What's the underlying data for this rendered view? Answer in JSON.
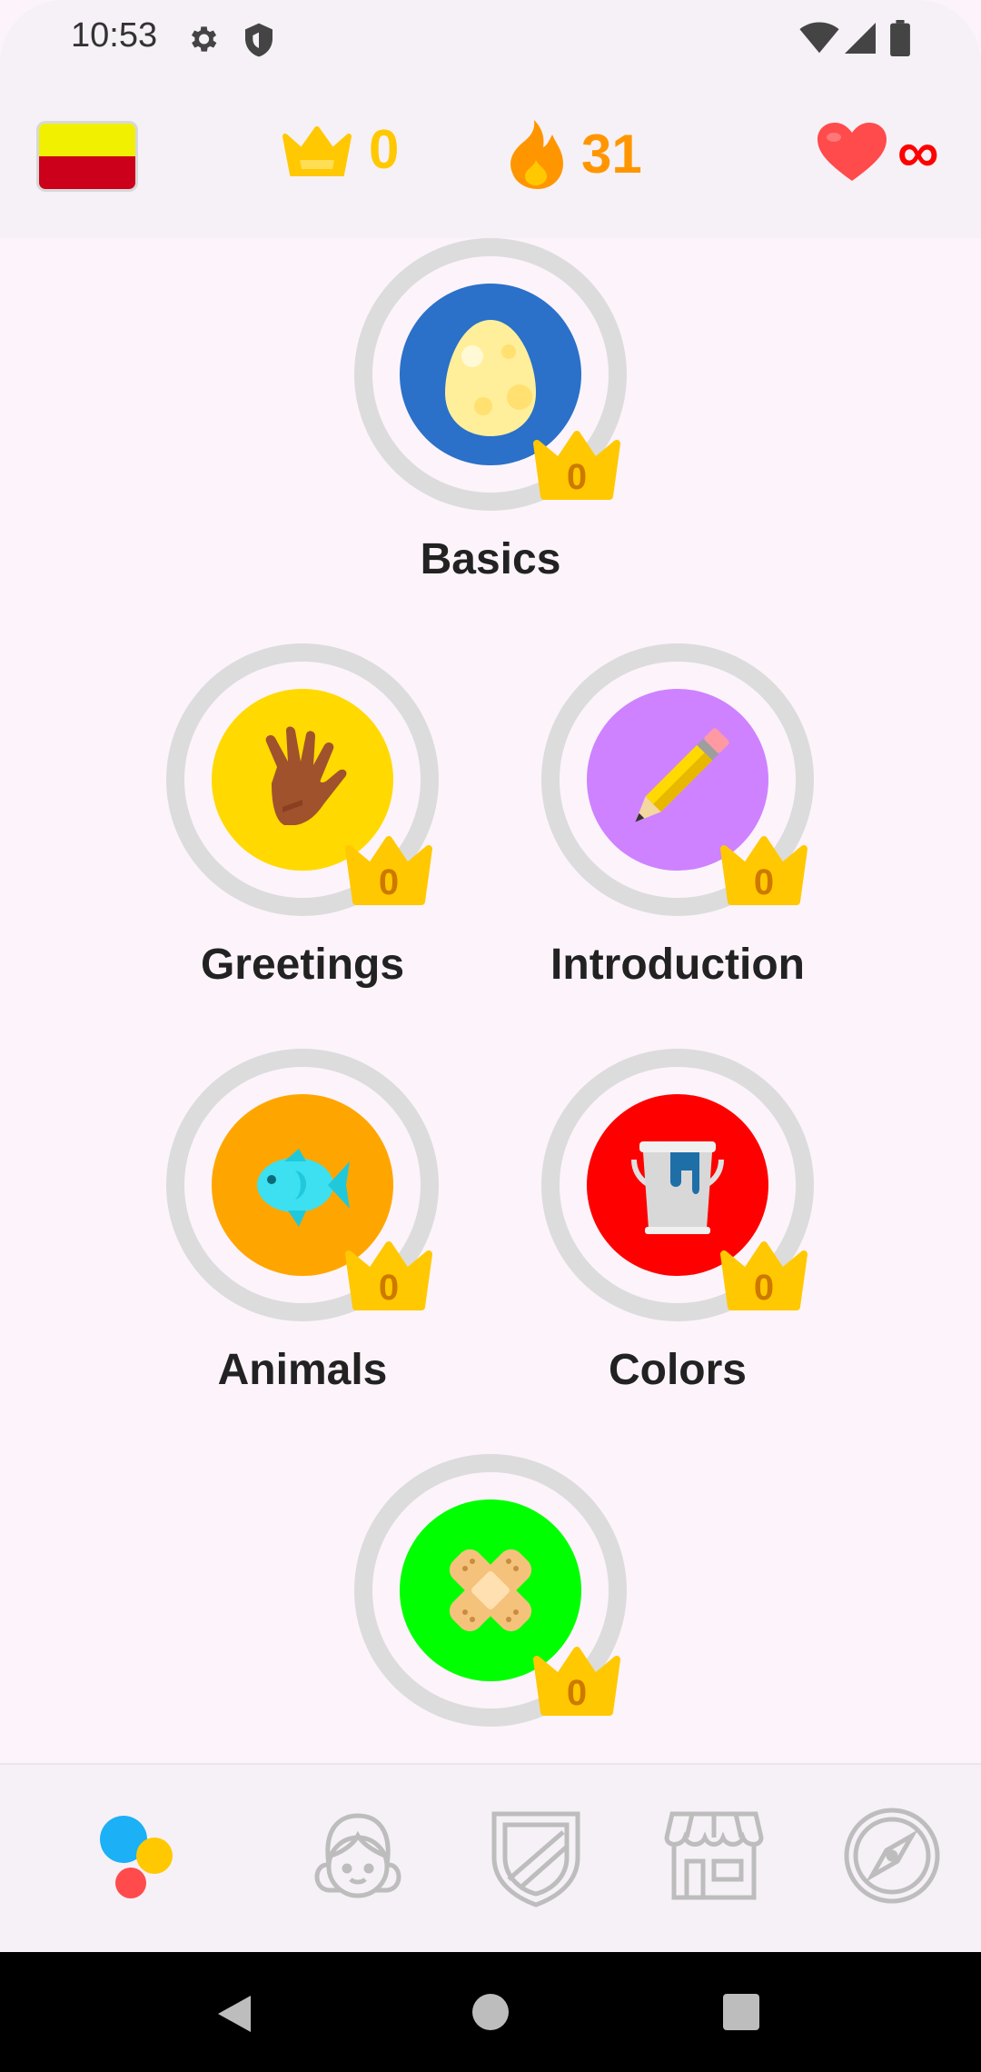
{
  "status_bar": {
    "time": "10:53"
  },
  "top_bar": {
    "crowns": "0",
    "streak": "31",
    "hearts": "∞",
    "colors": {
      "crown": "#ffc800",
      "streak": "#ff9600",
      "heart": "#ff4b4b",
      "hearts_value": "#ff0000"
    }
  },
  "skills": [
    {
      "name": "Basics",
      "icon": "egg-icon",
      "color": "#2b70c9",
      "crown_level": "0"
    },
    {
      "name": "Greetings",
      "icon": "hand-icon",
      "color": "#ffd900",
      "crown_level": "0"
    },
    {
      "name": "Introduction",
      "icon": "pencil-icon",
      "color": "#ce82ff",
      "crown_level": "0"
    },
    {
      "name": "Animals",
      "icon": "fish-icon",
      "color": "#ffa500",
      "crown_level": "0"
    },
    {
      "name": "Colors",
      "icon": "paint-bucket-icon",
      "color": "#ff0000",
      "crown_level": "0"
    },
    {
      "name": "",
      "icon": "bandage-icon",
      "color": "#00ff00",
      "crown_level": "0"
    }
  ],
  "bottom_nav": [
    {
      "name": "learn-tab",
      "icon": "dots-icon"
    },
    {
      "name": "profile-tab",
      "icon": "profile-icon"
    },
    {
      "name": "leagues-tab",
      "icon": "shield-icon"
    },
    {
      "name": "shop-tab",
      "icon": "shop-icon"
    },
    {
      "name": "explore-tab",
      "icon": "compass-icon"
    }
  ]
}
